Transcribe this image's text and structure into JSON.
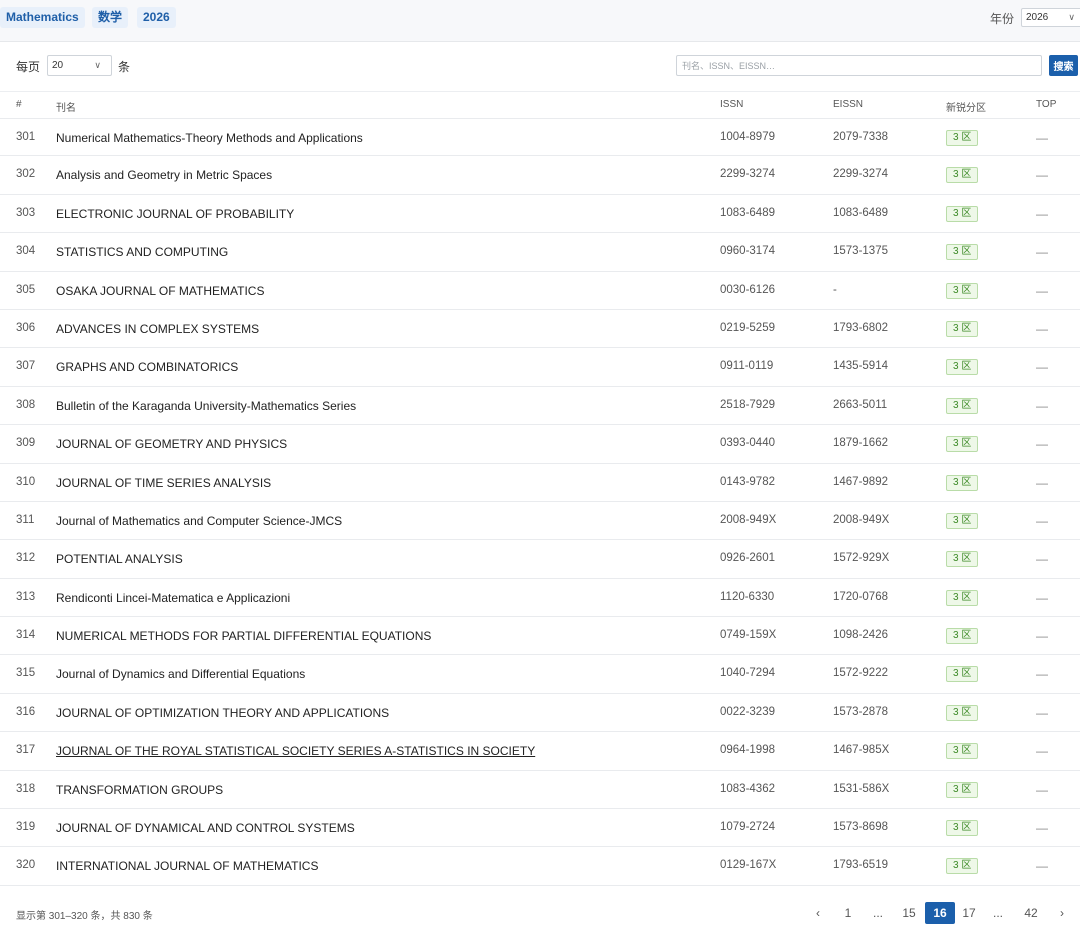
{
  "header": {
    "tags": [
      "Mathematics",
      "数学",
      "2026"
    ],
    "year_label": "年份",
    "year_value": "2026",
    "chevron_icon": "chevron-down-icon"
  },
  "toolbar": {
    "per_page_label": "每页",
    "per_page_value": "20",
    "per_page_unit": "条",
    "search_placeholder": "刊名、ISSN、EISSN…",
    "search_value": "",
    "search_button": "搜索"
  },
  "table": {
    "columns": [
      "#",
      "刊名",
      "ISSN",
      "EISSN",
      "新锐分区",
      "TOP"
    ],
    "rows": [
      {
        "num": "301",
        "name": "Numerical Mathematics-Theory Methods and Applications",
        "issn": "1004-8979",
        "eissn": "2079-7338",
        "zone": "3 区",
        "top": "—"
      },
      {
        "num": "302",
        "name": "Analysis and Geometry in Metric Spaces",
        "issn": "2299-3274",
        "eissn": "2299-3274",
        "zone": "3 区",
        "top": "—"
      },
      {
        "num": "303",
        "name": "ELECTRONIC JOURNAL OF PROBABILITY",
        "issn": "1083-6489",
        "eissn": "1083-6489",
        "zone": "3 区",
        "top": "—"
      },
      {
        "num": "304",
        "name": "STATISTICS AND COMPUTING",
        "issn": "0960-3174",
        "eissn": "1573-1375",
        "zone": "3 区",
        "top": "—"
      },
      {
        "num": "305",
        "name": "OSAKA JOURNAL OF MATHEMATICS",
        "issn": "0030-6126",
        "eissn": "-",
        "zone": "3 区",
        "top": "—"
      },
      {
        "num": "306",
        "name": "ADVANCES IN COMPLEX SYSTEMS",
        "issn": "0219-5259",
        "eissn": "1793-6802",
        "zone": "3 区",
        "top": "—"
      },
      {
        "num": "307",
        "name": "GRAPHS AND COMBINATORICS",
        "issn": "0911-0119",
        "eissn": "1435-5914",
        "zone": "3 区",
        "top": "—"
      },
      {
        "num": "308",
        "name": "Bulletin of the Karaganda University-Mathematics Series",
        "issn": "2518-7929",
        "eissn": "2663-5011",
        "zone": "3 区",
        "top": "—"
      },
      {
        "num": "309",
        "name": "JOURNAL OF GEOMETRY AND PHYSICS",
        "issn": "0393-0440",
        "eissn": "1879-1662",
        "zone": "3 区",
        "top": "—"
      },
      {
        "num": "310",
        "name": "JOURNAL OF TIME SERIES ANALYSIS",
        "issn": "0143-9782",
        "eissn": "1467-9892",
        "zone": "3 区",
        "top": "—"
      },
      {
        "num": "311",
        "name": "Journal of Mathematics and Computer Science-JMCS",
        "issn": "2008-949X",
        "eissn": "2008-949X",
        "zone": "3 区",
        "top": "—"
      },
      {
        "num": "312",
        "name": "POTENTIAL ANALYSIS",
        "issn": "0926-2601",
        "eissn": "1572-929X",
        "zone": "3 区",
        "top": "—"
      },
      {
        "num": "313",
        "name": "Rendiconti Lincei-Matematica e Applicazioni",
        "issn": "1120-6330",
        "eissn": "1720-0768",
        "zone": "3 区",
        "top": "—"
      },
      {
        "num": "314",
        "name": "NUMERICAL METHODS FOR PARTIAL DIFFERENTIAL EQUATIONS",
        "issn": "0749-159X",
        "eissn": "1098-2426",
        "zone": "3 区",
        "top": "—"
      },
      {
        "num": "315",
        "name": "Journal of Dynamics and Differential Equations",
        "issn": "1040-7294",
        "eissn": "1572-9222",
        "zone": "3 区",
        "top": "—"
      },
      {
        "num": "316",
        "name": "JOURNAL OF OPTIMIZATION THEORY AND APPLICATIONS",
        "issn": "0022-3239",
        "eissn": "1573-2878",
        "zone": "3 区",
        "top": "—"
      },
      {
        "num": "317",
        "name": "JOURNAL OF THE ROYAL STATISTICAL SOCIETY SERIES A-STATISTICS IN SOCIETY",
        "issn": "0964-1998",
        "eissn": "1467-985X",
        "zone": "3 区",
        "top": "—",
        "hovered": true
      },
      {
        "num": "318",
        "name": "TRANSFORMATION GROUPS",
        "issn": "1083-4362",
        "eissn": "1531-586X",
        "zone": "3 区",
        "top": "—"
      },
      {
        "num": "319",
        "name": "JOURNAL OF DYNAMICAL AND CONTROL SYSTEMS",
        "issn": "1079-2724",
        "eissn": "1573-8698",
        "zone": "3 区",
        "top": "—"
      },
      {
        "num": "320",
        "name": "INTERNATIONAL JOURNAL OF MATHEMATICS",
        "issn": "0129-167X",
        "eissn": "1793-6519",
        "zone": "3 区",
        "top": "—"
      }
    ]
  },
  "footer": {
    "summary": "显示第 301–320 条，共 830 条",
    "pagination": [
      "‹",
      "1",
      "...",
      "15",
      "16",
      "17",
      "...",
      "42",
      "›"
    ],
    "current_page": "16",
    "prev_icon": "chevron-left-icon",
    "next_icon": "chevron-right-icon"
  },
  "colors": {
    "brand": "#1b5fab",
    "tag_bg": "#e8f0fa",
    "zone_green": "#3c8a26",
    "zone_bg": "#eef8e8"
  }
}
